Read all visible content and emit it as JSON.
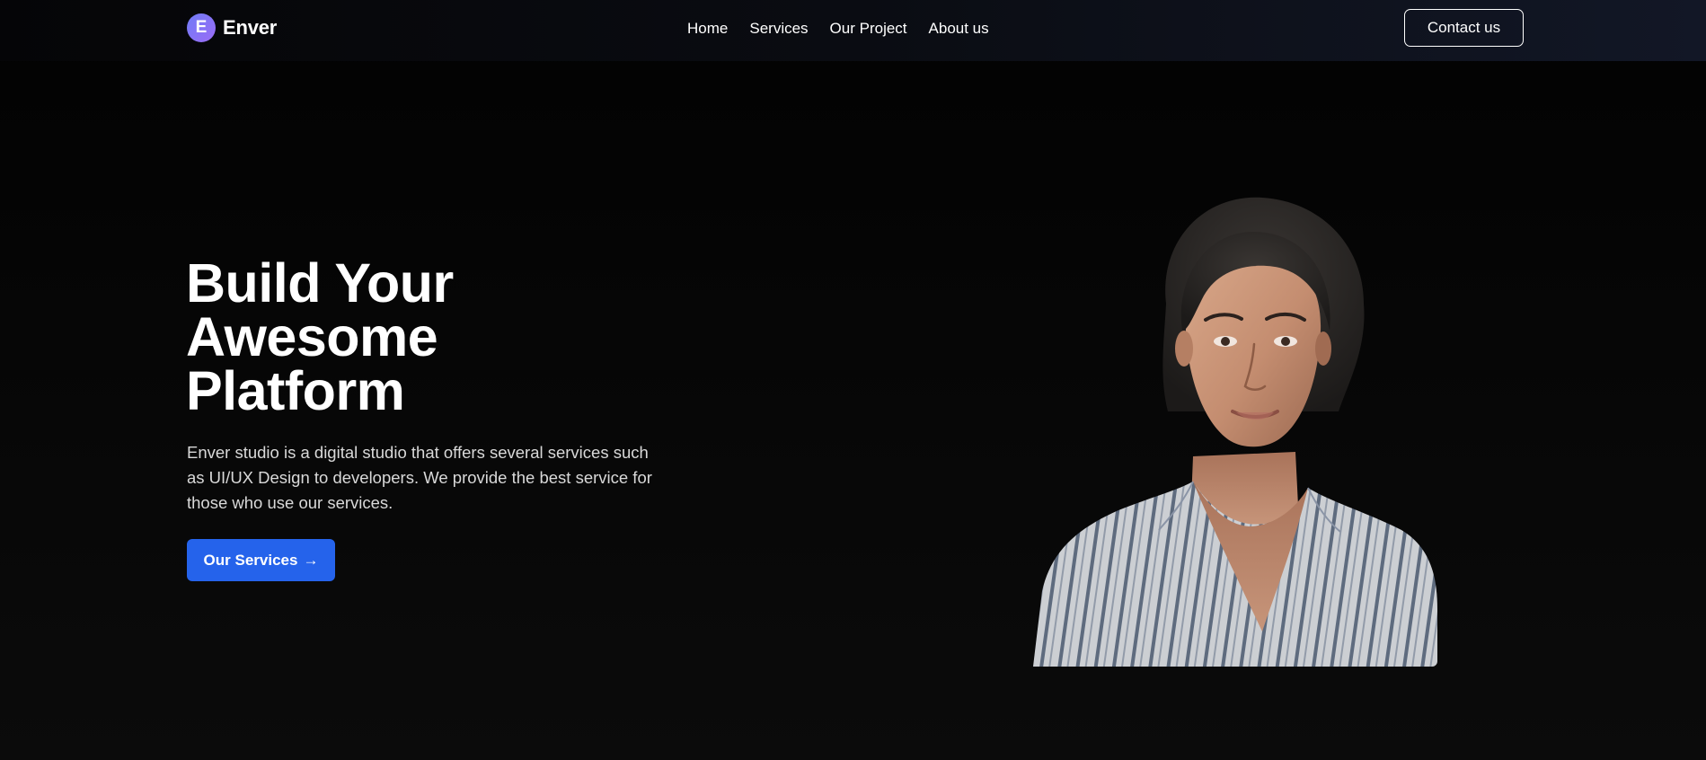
{
  "brand": {
    "logo_letter": "E",
    "name": "Enver"
  },
  "nav": {
    "links": [
      {
        "label": "Home"
      },
      {
        "label": "Services"
      },
      {
        "label": "Our Project"
      },
      {
        "label": "About us"
      }
    ],
    "contact_label": "Contact us"
  },
  "hero": {
    "title_lines": [
      "Build Your",
      "Awesome",
      "Platform"
    ],
    "description": "Enver studio is a digital studio that offers several services such as UI/UX Design to developers. We provide the best service for those who use our services.",
    "cta_label": "Our Services",
    "cta_icon": "arrow-right-icon",
    "cta_arrow": "→"
  },
  "colors": {
    "accent": "#2563eb",
    "background": "#050505",
    "logo_gradient_start": "#6f7cf5",
    "logo_gradient_end": "#9b6cf7"
  }
}
